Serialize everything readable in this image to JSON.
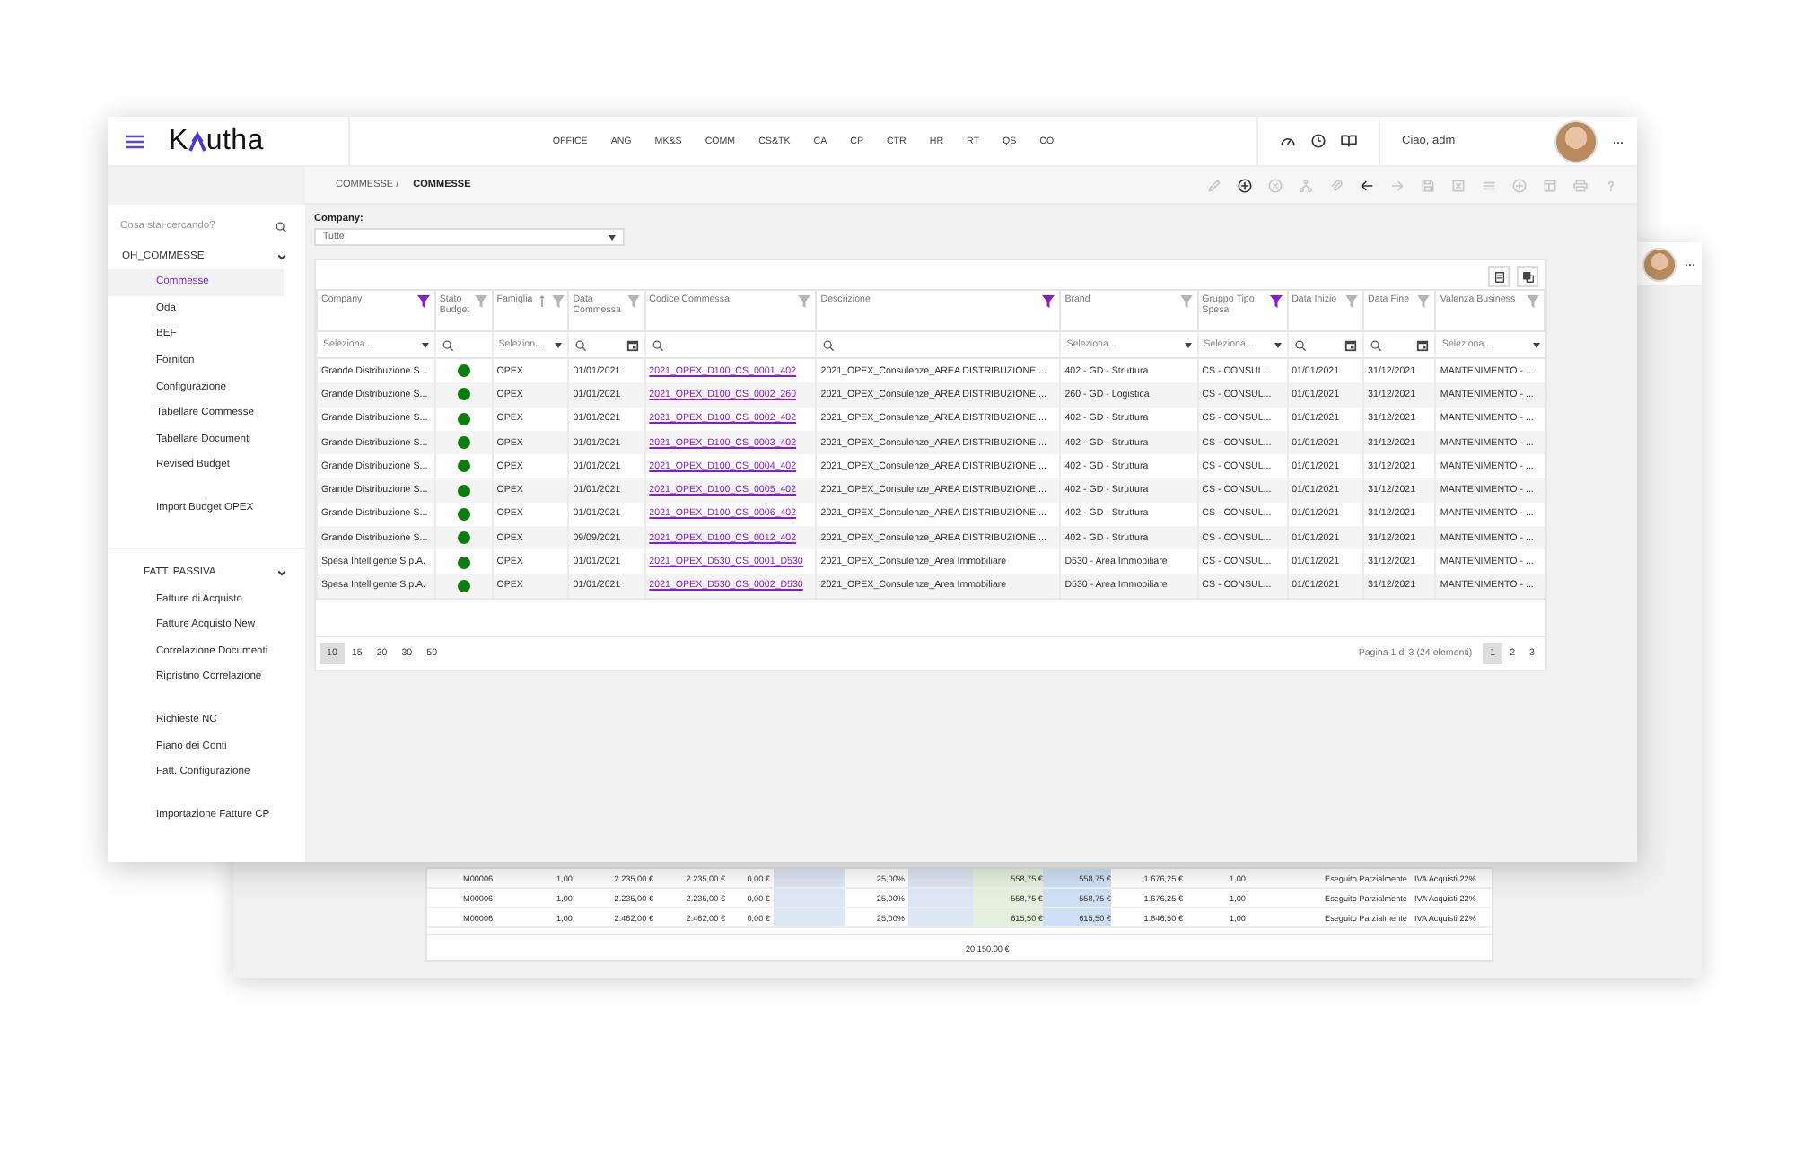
{
  "back_window": {
    "rows": [
      [
        "M00006",
        "1,00",
        "2.235,00 €",
        "2.235,00 €",
        "0,00 €",
        "25,00%",
        "558,75 €",
        "558,75 €",
        "1.676,25 €",
        "1,00",
        "Eseguito Parzialmente",
        "IVA Acquisti 22%"
      ],
      [
        "M00006",
        "1,00",
        "2.235,00 €",
        "2.235,00 €",
        "0,00 €",
        "25,00%",
        "558,75 €",
        "558,75 €",
        "1.676,25 €",
        "1,00",
        "Eseguito Parzialmente",
        "IVA Acquisti 22%"
      ],
      [
        "M00006",
        "1,00",
        "2.462,00 €",
        "2.462,00 €",
        "0,00 €",
        "25,00%",
        "615,50 €",
        "615,50 €",
        "1.846,50 €",
        "1,00",
        "Eseguito Parzialmente",
        "IVA Acquisti 22%"
      ]
    ],
    "total": "20.150,00 €",
    "menu": "···"
  },
  "header": {
    "logo_before": "K",
    "logo_after": "utha",
    "nav": [
      "OFFICE",
      "ANG",
      "MK&S",
      "COMM",
      "CS&TK",
      "CA",
      "CP",
      "CTR",
      "HR",
      "RT",
      "QS",
      "CO"
    ],
    "greeting": "Ciao, adm",
    "menu": "···"
  },
  "breadcrumb": {
    "parent": "COMMESSE /",
    "current": "COMMESSE"
  },
  "toolbar": [
    {
      "kind": "edit",
      "disabled": true
    },
    {
      "kind": "add",
      "disabled": false
    },
    {
      "kind": "cancel",
      "disabled": true
    },
    {
      "kind": "share",
      "disabled": true
    },
    {
      "kind": "attach",
      "disabled": true
    },
    {
      "kind": "back",
      "disabled": false
    },
    {
      "kind": "forward",
      "disabled": true
    },
    {
      "kind": "save",
      "disabled": true
    },
    {
      "kind": "delete",
      "disabled": true
    },
    {
      "kind": "list",
      "disabled": true
    },
    {
      "kind": "add",
      "disabled": true
    },
    {
      "kind": "layout",
      "disabled": true
    },
    {
      "kind": "print",
      "disabled": true
    },
    {
      "kind": "help",
      "disabled": true
    }
  ],
  "sidebar": {
    "search": {
      "placeholder": "Cosa stai cercando?"
    },
    "sections": [
      {
        "title": "OH_COMMESSE",
        "expanded": true,
        "groups": [
          [
            {
              "label": "Commesse",
              "selected": true
            },
            {
              "label": "Oda",
              "selected": false
            },
            {
              "label": "BEF",
              "selected": false
            },
            {
              "label": "Forniton",
              "selected": false
            },
            {
              "label": "Configurazione",
              "selected": false
            },
            {
              "label": "Tabellare Commesse",
              "selected": false
            },
            {
              "label": "Tabellare Documenti",
              "selected": false
            },
            {
              "label": "Revised Budget",
              "selected": false
            }
          ],
          [
            {
              "label": "Import Budget OPEX",
              "selected": false
            }
          ]
        ]
      },
      {
        "title": "FATT. PASSIVA",
        "expanded": true,
        "groups": [
          [
            {
              "label": "Fatture di Acquisto",
              "selected": false
            },
            {
              "label": "Fatture Acquisto New",
              "selected": false
            },
            {
              "label": "Correlazione Documenti",
              "selected": false
            },
            {
              "label": "Ripristino Correlazione",
              "selected": false
            }
          ],
          [
            {
              "label": "Richieste NC",
              "selected": false
            },
            {
              "label": "Piano dei Conti",
              "selected": false
            },
            {
              "label": "Fatt. Configurazione",
              "selected": false
            }
          ],
          [
            {
              "label": "Importazione Fatture CP",
              "selected": false
            }
          ]
        ]
      }
    ]
  },
  "company_filter": {
    "label": "Company:",
    "value": "Tutte"
  },
  "table": {
    "columns": [
      {
        "label": "Company",
        "filter_active": true,
        "filter": {
          "kind": "select",
          "placeholder": "Seleziona..."
        }
      },
      {
        "label": "Stato Budget",
        "filter_active": false,
        "filter": {
          "kind": "search"
        }
      },
      {
        "label": "Famiglia",
        "filter_active": false,
        "sortable": true,
        "filter": {
          "kind": "select",
          "placeholder": "Selezion..."
        }
      },
      {
        "label": "Data Commessa",
        "filter_active": false,
        "filter": {
          "kind": "date"
        }
      },
      {
        "label": "Codice Commessa",
        "filter_active": false,
        "filter": {
          "kind": "search"
        }
      },
      {
        "label": "Descrizione",
        "filter_active": true,
        "filter": {
          "kind": "search"
        }
      },
      {
        "label": "Brand",
        "filter_active": false,
        "filter": {
          "kind": "select",
          "placeholder": "Seleziona..."
        }
      },
      {
        "label": "Gruppo Tipo Spesa",
        "filter_active": true,
        "filter": {
          "kind": "select",
          "placeholder": "Seleziona..."
        }
      },
      {
        "label": "Data Inizio",
        "filter_active": false,
        "filter": {
          "kind": "date"
        }
      },
      {
        "label": "Data Fine",
        "filter_active": false,
        "filter": {
          "kind": "date"
        }
      },
      {
        "label": "Valenza Business",
        "filter_active": false,
        "filter": {
          "kind": "select",
          "placeholder": "Seleziona..."
        }
      }
    ],
    "rows": [
      {
        "company": "Grande Distribuzione S...",
        "color": "#0a7d0a",
        "famiglia": "OPEX",
        "data": "01/01/2021",
        "codice": "2021_OPEX_D100_CS_0001_402",
        "descrizione": "2021_OPEX_Consulenze_AREA DISTRIBUZIONE ...",
        "brand": "402 - GD - Struttura",
        "gruppo": "CS - CONSUL...",
        "inizio": "01/01/2021",
        "fine": "31/12/2021",
        "valenza": "MANTENIMENTO - ..."
      },
      {
        "company": "Grande Distribuzione S...",
        "color": "#0a7d0a",
        "famiglia": "OPEX",
        "data": "01/01/2021",
        "codice": "2021_OPEX_D100_CS_0002_260",
        "descrizione": "2021_OPEX_Consulenze_AREA DISTRIBUZIONE ...",
        "brand": "260 - GD - Logistica",
        "gruppo": "CS - CONSUL...",
        "inizio": "01/01/2021",
        "fine": "31/12/2021",
        "valenza": "MANTENIMENTO - ..."
      },
      {
        "company": "Grande Distribuzione S...",
        "color": "#0a7d0a",
        "famiglia": "OPEX",
        "data": "01/01/2021",
        "codice": "2021_OPEX_D100_CS_0002_402",
        "descrizione": "2021_OPEX_Consulenze_AREA DISTRIBUZIONE ...",
        "brand": "402 - GD - Struttura",
        "gruppo": "CS - CONSUL...",
        "inizio": "01/01/2021",
        "fine": "31/12/2021",
        "valenza": "MANTENIMENTO - ..."
      },
      {
        "company": "Grande Distribuzione S...",
        "color": "#0a7d0a",
        "famiglia": "OPEX",
        "data": "01/01/2021",
        "codice": "2021_OPEX_D100_CS_0003_402",
        "descrizione": "2021_OPEX_Consulenze_AREA DISTRIBUZIONE ...",
        "brand": "402 - GD - Struttura",
        "gruppo": "CS - CONSUL...",
        "inizio": "01/01/2021",
        "fine": "31/12/2021",
        "valenza": "MANTENIMENTO - ..."
      },
      {
        "company": "Grande Distribuzione S...",
        "color": "#0a7d0a",
        "famiglia": "OPEX",
        "data": "01/01/2021",
        "codice": "2021_OPEX_D100_CS_0004_402",
        "descrizione": "2021_OPEX_Consulenze_AREA DISTRIBUZIONE ...",
        "brand": "402 - GD - Struttura",
        "gruppo": "CS - CONSUL...",
        "inizio": "01/01/2021",
        "fine": "31/12/2021",
        "valenza": "MANTENIMENTO - ..."
      },
      {
        "company": "Grande Distribuzione S...",
        "color": "#0a7d0a",
        "famiglia": "OPEX",
        "data": "01/01/2021",
        "codice": "2021_OPEX_D100_CS_0005_402",
        "descrizione": "2021_OPEX_Consulenze_AREA DISTRIBUZIONE ...",
        "brand": "402 - GD - Struttura",
        "gruppo": "CS - CONSUL...",
        "inizio": "01/01/2021",
        "fine": "31/12/2021",
        "valenza": "MANTENIMENTO - ..."
      },
      {
        "company": "Grande Distribuzione S...",
        "color": "#0a7d0a",
        "famiglia": "OPEX",
        "data": "01/01/2021",
        "codice": "2021_OPEX_D100_CS_0006_402",
        "descrizione": "2021_OPEX_Consulenze_AREA DISTRIBUZIONE ...",
        "brand": "402 - GD - Struttura",
        "gruppo": "CS - CONSUL...",
        "inizio": "01/01/2021",
        "fine": "31/12/2021",
        "valenza": "MANTENIMENTO - ..."
      },
      {
        "company": "Grande Distribuzione S...",
        "color": "#0a7d0a",
        "famiglia": "OPEX",
        "data": "09/09/2021",
        "codice": "2021_OPEX_D100_CS_0012_402",
        "descrizione": "2021_OPEX_Consulenze_AREA DISTRIBUZIONE ...",
        "brand": "402 - GD - Struttura",
        "gruppo": "CS - CONSUL...",
        "inizio": "01/01/2021",
        "fine": "31/12/2021",
        "valenza": "MANTENIMENTO - ..."
      },
      {
        "company": "Spesa Intelligente S.p.A.",
        "color": "#0a7d0a",
        "famiglia": "OPEX",
        "data": "01/01/2021",
        "codice": "2021_OPEX_D530_CS_0001_D530",
        "descrizione": "2021_OPEX_Consulenze_Area Immobiliare",
        "brand": "D530 - Area Immobiliare",
        "gruppo": "CS - CONSUL...",
        "inizio": "01/01/2021",
        "fine": "31/12/2021",
        "valenza": "MANTENIMENTO - ..."
      },
      {
        "company": "Spesa Intelligente S.p.A.",
        "color": "#0a7d0a",
        "famiglia": "OPEX",
        "data": "01/01/2021",
        "codice": "2021_OPEX_D530_CS_0002_D530",
        "descrizione": "2021_OPEX_Consulenze_Area Immobiliare",
        "brand": "D530 - Area Immobiliare",
        "gruppo": "CS - CONSUL...",
        "inizio": "01/01/2021",
        "fine": "31/12/2021",
        "valenza": "MANTENIMENTO - ..."
      }
    ]
  },
  "pager": {
    "sizes": [
      {
        "label": "10",
        "selected": true
      },
      {
        "label": "15",
        "selected": false
      },
      {
        "label": "20",
        "selected": false
      },
      {
        "label": "30",
        "selected": false
      },
      {
        "label": "50",
        "selected": false
      }
    ],
    "info": "Pagina 1 di 3 (24 elementi)",
    "pages": [
      {
        "label": "1",
        "selected": true
      },
      {
        "label": "2",
        "selected": false
      },
      {
        "label": "3",
        "selected": false
      }
    ]
  }
}
